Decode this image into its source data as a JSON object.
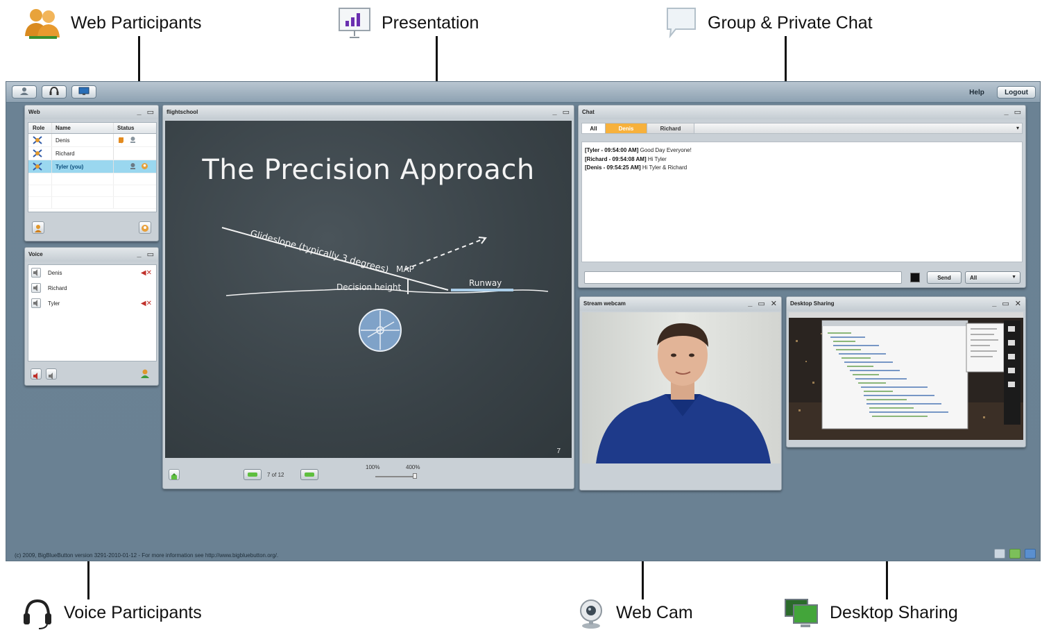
{
  "callouts": {
    "web_participants": "Web Participants",
    "presentation": "Presentation",
    "chat": "Group & Private Chat",
    "voice_participants": "Voice Participants",
    "web_cam": "Web Cam",
    "desktop_sharing": "Desktop Sharing"
  },
  "topbar": {
    "help": "Help",
    "logout": "Logout"
  },
  "web_panel": {
    "title": "Web",
    "columns": [
      "Role",
      "Name",
      "Status"
    ],
    "participants": [
      {
        "name": "Denis",
        "selected": false
      },
      {
        "name": "Richard",
        "selected": false
      },
      {
        "name": "Tyler (you)",
        "selected": true
      }
    ]
  },
  "voice_panel": {
    "title": "Voice",
    "participants": [
      {
        "name": "Denis",
        "muted": true
      },
      {
        "name": "Richard",
        "muted": false
      },
      {
        "name": "Tyler",
        "muted": true
      }
    ]
  },
  "presentation_panel": {
    "title": "flightschool",
    "slide": {
      "title": "The Precision Approach",
      "labels": {
        "glideslope": "Glideslope (typically 3 degrees)",
        "map": "MAP",
        "decision_height": "Decision height",
        "runway": "Runway"
      },
      "page_number": "7"
    },
    "page_indicator": "7 of 12",
    "zoom_min": "100%",
    "zoom_max": "400%"
  },
  "chat_panel": {
    "title": "Chat",
    "tabs": [
      "All",
      "Denis",
      "Richard"
    ],
    "messages": [
      {
        "sender": "[Tyler - 09:54:00 AM]",
        "text": "Good Day Everyone!"
      },
      {
        "sender": "[Richard - 09:54:08 AM]",
        "text": "Hi Tyler"
      },
      {
        "sender": "[Denis - 09:54:25 AM]",
        "text": "Hi Tyler & Richard"
      }
    ],
    "send_label": "Send",
    "recipient": "All"
  },
  "webcam_panel": {
    "title": "Stream webcam"
  },
  "desktop_panel": {
    "title": "Desktop Sharing"
  },
  "footer": "(c) 2009, BigBlueButton version 3291-2010-01-12 - For more information see http://www.bigbluebutton.org/.",
  "colors": {
    "canvas": "#6a8193",
    "selected_row": "#9ad7ef",
    "private_tab": "#f7b13c",
    "nav_arrow": "#5fbf3f"
  }
}
